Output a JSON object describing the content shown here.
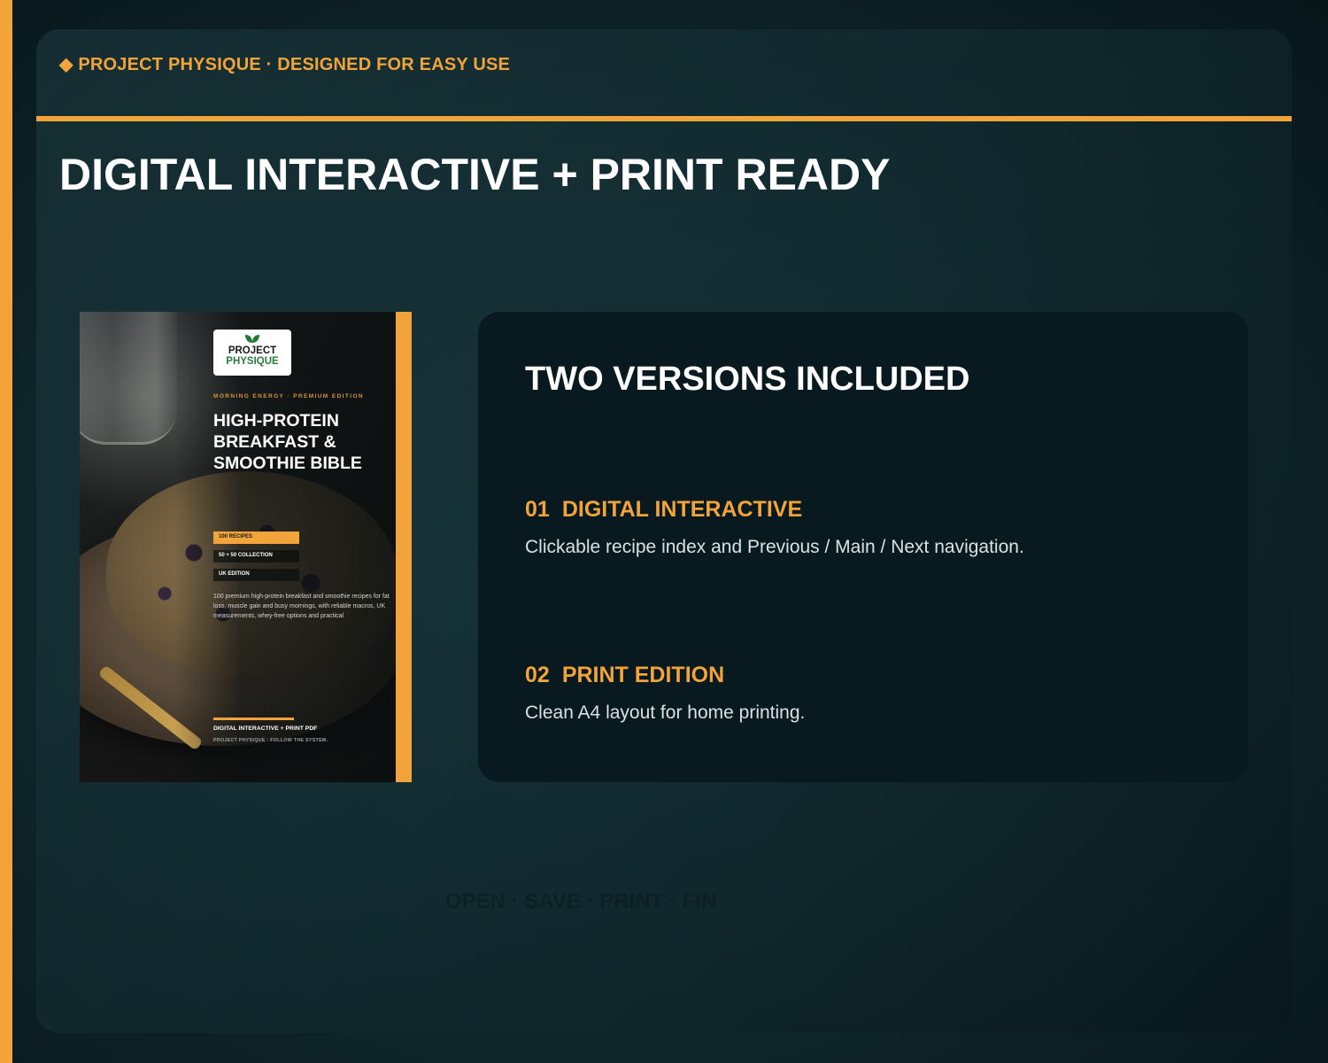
{
  "brand": {
    "top_label": "◆ PROJECT PHYSIQUE · DESIGNED FOR EASY USE",
    "accent_color": "#f2a33a"
  },
  "heading": "DIGITAL INTERACTIVE + PRINT READY",
  "cover": {
    "logo_line1": "PROJECT",
    "logo_line2": "PHYSIQUE",
    "kicker": "MORNING ENERGY · PREMIUM EDITION",
    "title": "HIGH-PROTEIN BREAKFAST & SMOOTHIE BIBLE",
    "tags": [
      "100 RECIPES",
      "50 + 50 COLLECTION",
      "UK EDITION"
    ],
    "blurb": "100 premium high-protein breakfast and smoothie recipes for fat loss, muscle gain and busy mornings, with reliable macros, UK measurements, whey-free options and practical",
    "footer_line1": "DIGITAL INTERACTIVE + PRINT PDF",
    "footer_line2": "PROJECT PHYSIQUE · FOLLOW THE SYSTEM."
  },
  "card": {
    "title": "TWO VERSIONS INCLUDED",
    "features": [
      {
        "number": "01",
        "title": "DIGITAL INTERACTIVE",
        "description": "Clickable recipe index and Previous / Main / Next navigation."
      },
      {
        "number": "02",
        "title": "PRINT EDITION",
        "description": "Clean A4 layout for home printing."
      }
    ]
  },
  "ghost_text": "OPEN · SAVE · PRINT · FIN"
}
